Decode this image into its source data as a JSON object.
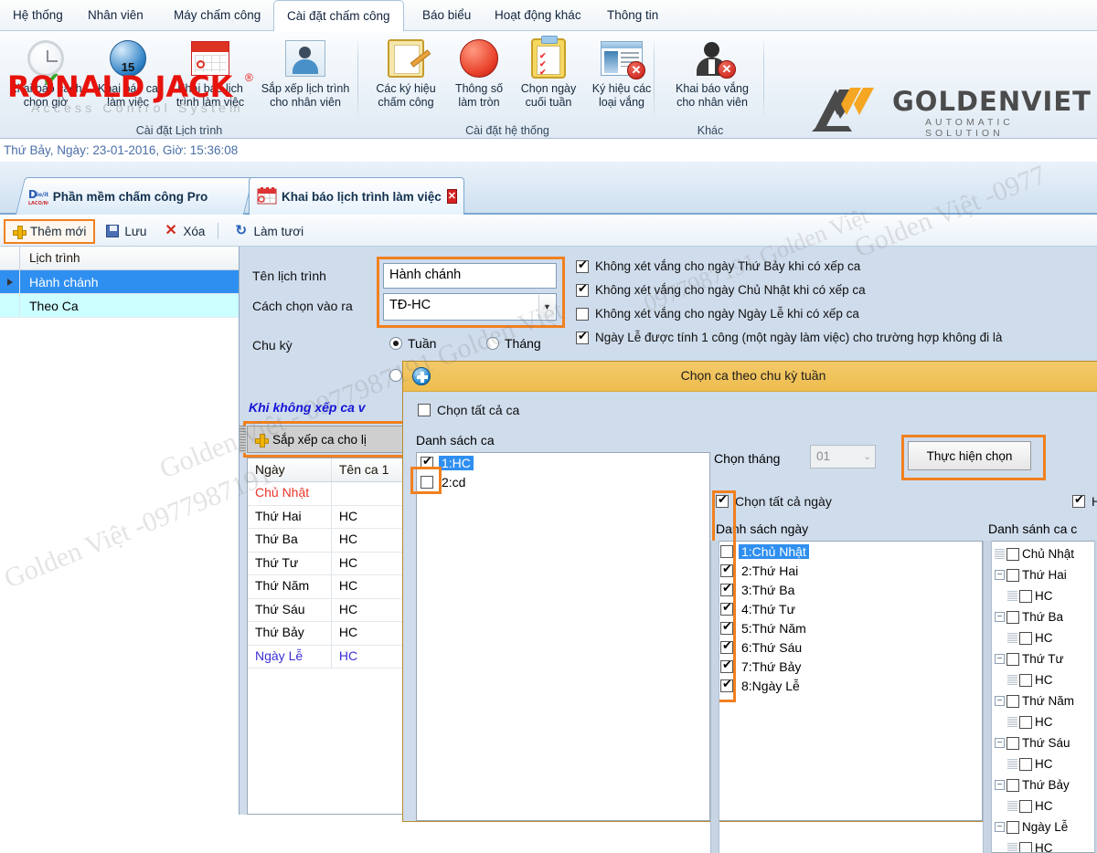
{
  "menu": {
    "items": [
      {
        "label": "Hệ thống",
        "active": false
      },
      {
        "label": "Nhân viên",
        "active": false
      },
      {
        "label": "Máy chấm công",
        "active": false
      },
      {
        "label": "Cài đặt chấm công",
        "active": true
      },
      {
        "label": "Báo biểu",
        "active": false
      },
      {
        "label": "Hoạt động khác",
        "active": false
      },
      {
        "label": "Thông tin",
        "active": false
      }
    ]
  },
  "brand": {
    "ronald_jack": "RONALD JACK",
    "registered": "®",
    "tagline": "Access Control System",
    "golden_viet": "GOLDENVIET",
    "golden_viet_sub": "AUTOMATIC SOLUTION"
  },
  "ribbon": {
    "groups": [
      {
        "title": "Cài đặt Lịch trình",
        "buttons": [
          {
            "label": "Khai báo cách\nchọn giờ",
            "icon": "clock-check-icon"
          },
          {
            "label": "Khai báo ca\nlàm việc",
            "icon": "globe-15-icon"
          },
          {
            "label": "Khai báo lịch\ntrình làm việc",
            "icon": "calendar-icon"
          },
          {
            "label": "Sắp xếp lịch trình\ncho nhân viên",
            "icon": "user-card-icon"
          }
        ]
      },
      {
        "title": "Cài đặt hệ thống",
        "buttons": [
          {
            "label": "Các ký hiệu\nchấm công",
            "icon": "notepad-pencil-icon"
          },
          {
            "label": "Thông số\nlàm tròn",
            "icon": "red-circle-icon"
          },
          {
            "label": "Chọn ngày\ncuối tuần",
            "icon": "clipboard-check-icon"
          },
          {
            "label": "Ký hiệu các\nloại vắng",
            "icon": "window-delete-icon"
          }
        ]
      },
      {
        "title": "Khác",
        "buttons": [
          {
            "label": "Khai báo vắng\ncho nhân viên",
            "icon": "person-delete-icon"
          }
        ]
      }
    ]
  },
  "statusbar": {
    "text": "Thứ Bảy, Ngày: 23-01-2016, Giờ: 15:36:08"
  },
  "doctabs": [
    {
      "label": "Phần mềm chấm công Pro",
      "closable": false,
      "icon": "app-icon"
    },
    {
      "label": "Khai báo lịch trình làm việc",
      "closable": true,
      "icon": "calendar-small-icon",
      "close": "✕"
    }
  ],
  "toolbar": {
    "add_label": "Thêm mới",
    "save_label": "Lưu",
    "delete_label": "Xóa",
    "refresh_label": "Làm tươi"
  },
  "left_grid": {
    "header": "Lịch trình",
    "rows": [
      {
        "label": "Hành chánh",
        "state": "selected"
      },
      {
        "label": "Theo Ca",
        "state": "alt"
      }
    ]
  },
  "form": {
    "name_label": "Tên lịch trình",
    "name_value": "Hành chánh",
    "mode_label": "Cách chọn vào ra",
    "mode_value": "TĐ-HC",
    "cycle_label": "Chu kỳ",
    "cycle_week": "Tuần",
    "cycle_month": "Tháng",
    "cycle_selected": "Tuần",
    "note": "Khi không xếp ca v",
    "arrange_button": "Sắp xếp ca cho lị"
  },
  "options": [
    {
      "label": "Không xét vắng cho ngày Thứ Bảy khi có xếp ca",
      "checked": true
    },
    {
      "label": "Không xét vắng cho ngày Chủ Nhật khi có xếp ca",
      "checked": true
    },
    {
      "label": "Không xét vắng cho ngày Ngày Lễ khi có xếp ca",
      "checked": false
    },
    {
      "label": "Ngày Lễ được tính 1 công (một ngày làm việc) cho trường hợp không đi là",
      "checked": true
    }
  ],
  "schedule_table": {
    "columns": [
      "Ngày",
      "Tên ca 1",
      ""
    ],
    "rows": [
      {
        "day": "Chủ Nhật",
        "shift": "",
        "color": "#e8342a"
      },
      {
        "day": "Thứ Hai",
        "shift": "HC",
        "color": "#101010"
      },
      {
        "day": "Thứ Ba",
        "shift": "HC",
        "color": "#101010"
      },
      {
        "day": "Thứ Tư",
        "shift": "HC",
        "color": "#101010"
      },
      {
        "day": "Thứ Năm",
        "shift": "HC",
        "color": "#101010"
      },
      {
        "day": "Thứ Sáu",
        "shift": "HC",
        "color": "#101010"
      },
      {
        "day": "Thứ Bảy",
        "shift": "HC",
        "color": "#101010"
      },
      {
        "day": "Ngày Lễ",
        "shift": "HC",
        "color": "#3a2fd6"
      }
    ]
  },
  "dialog": {
    "title": "Chọn ca theo chu kỳ tuần",
    "select_all_shifts_label": "Chọn tất cả ca",
    "select_all_shifts_checked": false,
    "shift_list_label": "Danh sách ca",
    "shifts": [
      {
        "label": "1:HC",
        "checked": true,
        "selected": true
      },
      {
        "label": "2:cd",
        "checked": false,
        "selected": false
      }
    ],
    "month_label": "Chọn tháng",
    "month_value": "01",
    "apply_button": "Thực hiện chọn",
    "select_all_days_label": "Chọn tất cả ngày",
    "select_all_days_checked": true,
    "day_list_label": "Danh sách ngày",
    "days": [
      {
        "label": "1:Chủ Nhật",
        "checked": false,
        "selected": true
      },
      {
        "label": "2:Thứ Hai",
        "checked": true,
        "selected": false
      },
      {
        "label": "3:Thứ Ba",
        "checked": true,
        "selected": false
      },
      {
        "label": "4:Thứ Tư",
        "checked": true,
        "selected": false
      },
      {
        "label": "5:Thứ Năm",
        "checked": true,
        "selected": false
      },
      {
        "label": "6:Thứ Sáu",
        "checked": true,
        "selected": false
      },
      {
        "label": "7:Thứ Bảy",
        "checked": true,
        "selected": false
      },
      {
        "label": "8:Ngày Lễ",
        "checked": true,
        "selected": false
      }
    ],
    "right_checkbox_label": "H",
    "right_checkbox_checked": true,
    "tree_label": "Danh sánh ca c",
    "tree": [
      {
        "label": "Chủ Nhật",
        "expander": "none",
        "children": []
      },
      {
        "label": "Thứ Hai",
        "expander": "minus",
        "children": [
          "HC"
        ]
      },
      {
        "label": "Thứ Ba",
        "expander": "minus",
        "children": [
          "HC"
        ]
      },
      {
        "label": "Thứ Tư",
        "expander": "minus",
        "children": [
          "HC"
        ]
      },
      {
        "label": "Thứ Năm",
        "expander": "minus",
        "children": [
          "HC"
        ]
      },
      {
        "label": "Thứ Sáu",
        "expander": "minus",
        "children": [
          "HC"
        ]
      },
      {
        "label": "Thứ Bảy",
        "expander": "minus",
        "children": [
          "HC"
        ]
      },
      {
        "label": "Ngày Lễ",
        "expander": "minus",
        "children": [
          "HC"
        ]
      }
    ]
  },
  "watermarks": [
    "Golden Việt -0977987191",
    "0977987191 Golden Việt",
    "Golden Việt -0977",
    "Golden Việt - 0977987191 Golden Việt"
  ],
  "colors": {
    "accent_orange": "#f0801f",
    "select_blue": "#2f8ff0",
    "dialog_caption": "#efc05a",
    "pane_bg": "#cfdcec"
  }
}
